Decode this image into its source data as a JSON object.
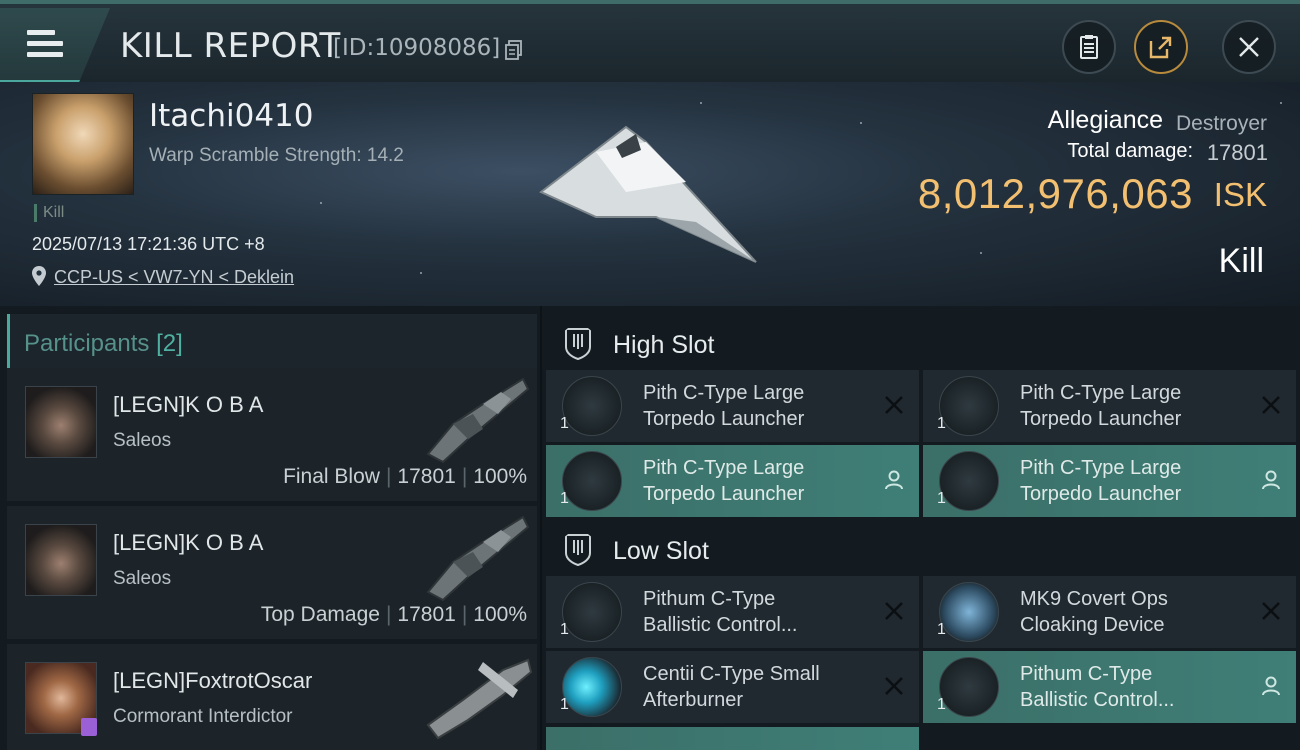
{
  "header": {
    "title": "KILL REPORT",
    "report_id": "[ID:10908086]",
    "buttons": [
      "clipboard-icon",
      "share-icon",
      "close-icon"
    ]
  },
  "victim": {
    "name": "Itachi0410",
    "warp_scramble": "Warp Scramble Strength: 14.2",
    "tag": "Kill",
    "datetime": "2025/07/13 17:21:36 UTC +8",
    "location": "CCP-US < VW7-YN < Deklein",
    "allegiance_label": "Allegiance",
    "allegiance_value": "Destroyer",
    "total_damage_label": "Total damage:",
    "total_damage_value": "17801",
    "isk_value": "8,012,976,063",
    "isk_unit": "ISK",
    "result": "Kill"
  },
  "participants": {
    "label": "Participants",
    "count": "[2]",
    "items": [
      {
        "name": "[LEGN]K O B A",
        "ship": "Saleos",
        "role": "Final Blow",
        "damage": "17801",
        "percent": "100%"
      },
      {
        "name": "[LEGN]K O B A",
        "ship": "Saleos",
        "role": "Top Damage",
        "damage": "17801",
        "percent": "100%"
      },
      {
        "name": "[LEGN]FoxtrotOscar",
        "ship": "Cormorant Interdictor"
      }
    ]
  },
  "slots": {
    "high": {
      "title": "High Slot",
      "modules": [
        {
          "line1": "Pith C-Type Large",
          "line2": "Torpedo Launcher",
          "qty": "1",
          "state": "destroyed"
        },
        {
          "line1": "Pith C-Type Large",
          "line2": "Torpedo Launcher",
          "qty": "1",
          "state": "destroyed"
        },
        {
          "line1": "Pith C-Type Large",
          "line2": "Torpedo Launcher",
          "qty": "1",
          "state": "dropped"
        },
        {
          "line1": "Pith C-Type Large",
          "line2": "Torpedo Launcher",
          "qty": "1",
          "state": "dropped"
        }
      ]
    },
    "low": {
      "title": "Low Slot",
      "modules": [
        {
          "line1": "Pithum C-Type",
          "line2": "Ballistic Control...",
          "qty": "1",
          "state": "destroyed"
        },
        {
          "line1": "MK9 Covert Ops",
          "line2": "Cloaking Device",
          "qty": "1",
          "state": "destroyed"
        },
        {
          "line1": "Centii C-Type Small",
          "line2": "Afterburner",
          "qty": "1",
          "state": "destroyed"
        },
        {
          "line1": "Pithum C-Type",
          "line2": "Ballistic Control...",
          "qty": "1",
          "state": "dropped"
        }
      ]
    }
  },
  "colors": {
    "accent": "#4aa89c",
    "isk": "#f2c070",
    "dropped_bg": "#3f7f77"
  }
}
